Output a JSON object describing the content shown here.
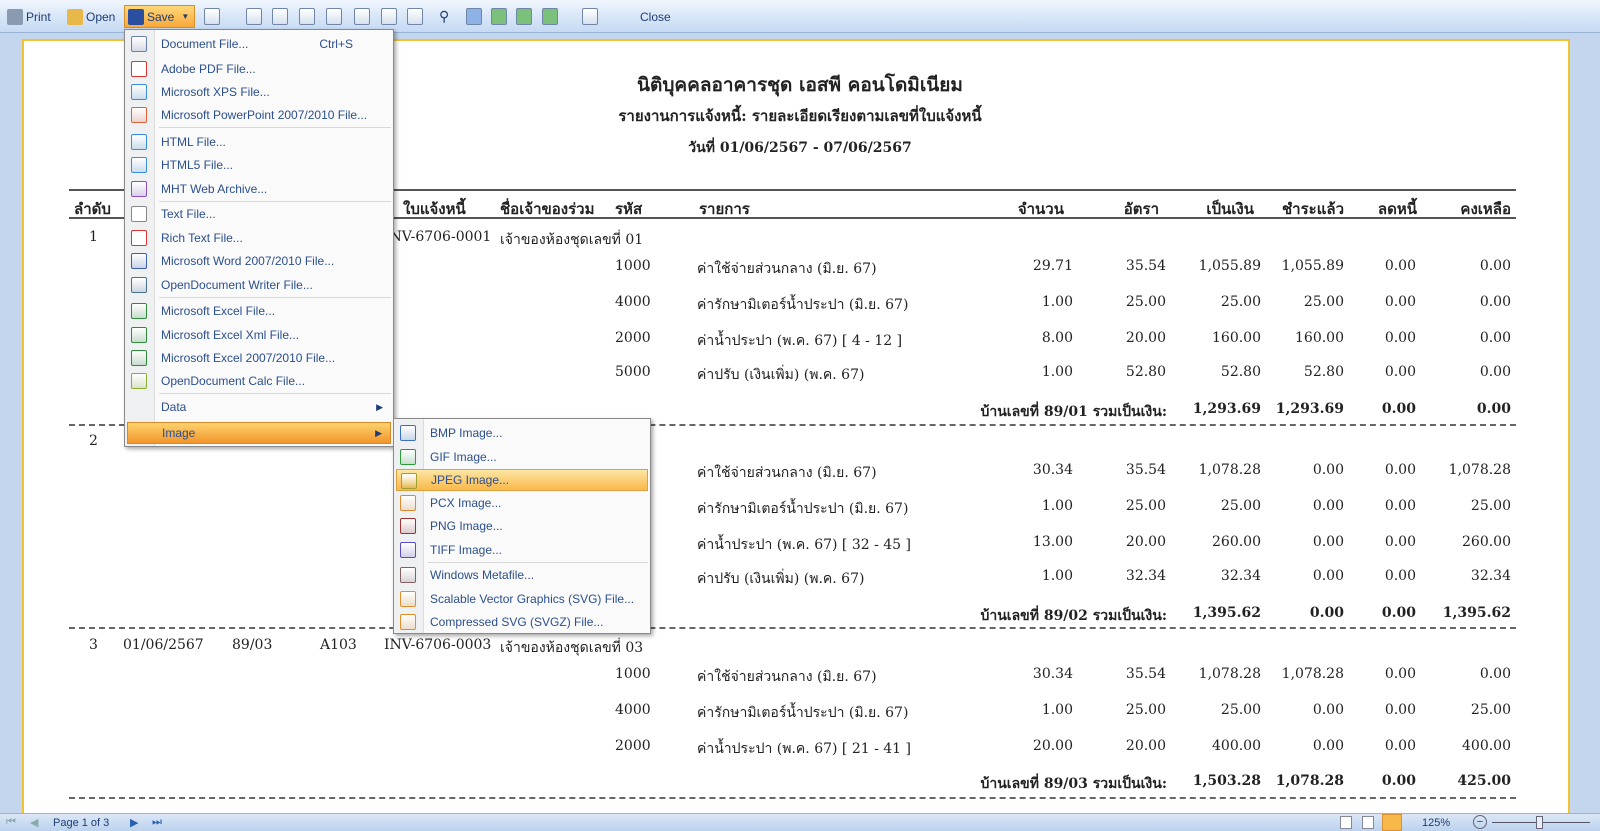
{
  "toolbar": {
    "print": "Print",
    "open": "Open",
    "save": "Save",
    "close": "Close"
  },
  "report": {
    "title": "นิติบุคคลอาคารชุด เอสพี คอนโดมิเนียม",
    "subtitle": "รายงานการแจ้งหนี้: รายละเอียดเรียงตามเลขที่ใบแจ้งหนี้",
    "date_range": "วันที่ 01/06/2567 - 07/06/2567",
    "columns": {
      "seq": "ลำดับ",
      "invoice": "ใบแจ้งหนี้",
      "owner": "ชื่อเจ้าของร่วม",
      "code": "รหัส",
      "item": "รายการ",
      "qty": "จำนวน",
      "rate": "อัตรา",
      "amount": "เป็นเงิน",
      "paid": "ชำระแล้ว",
      "discount": "ลดหนี้",
      "balance": "คงเหลือ"
    },
    "groups": [
      {
        "seq": "1",
        "date": "",
        "house": "",
        "room": "",
        "invoice": "INV-6706-0001",
        "owner": "เจ้าของห้องชุดเลขที่ 01",
        "lines": [
          [
            "1000",
            "ค่าใช้จ่ายส่วนกลาง (มิ.ย. 67)",
            "29.71",
            "35.54",
            "1,055.89",
            "1,055.89",
            "0.00",
            "0.00"
          ],
          [
            "4000",
            "ค่ารักษามิเตอร์น้ำประปา (มิ.ย. 67)",
            "1.00",
            "25.00",
            "25.00",
            "25.00",
            "0.00",
            "0.00"
          ],
          [
            "2000",
            "ค่าน้ำประปา (พ.ค. 67) [ 4 - 12 ]",
            "8.00",
            "20.00",
            "160.00",
            "160.00",
            "0.00",
            "0.00"
          ],
          [
            "5000",
            "ค่าปรับ (เงินเพิ่ม) (พ.ค. 67)",
            "1.00",
            "52.80",
            "52.80",
            "52.80",
            "0.00",
            "0.00"
          ]
        ],
        "total": {
          "label": "บ้านเลขที่ 89/01 รวมเป็นเงิน:",
          "amount": "1,293.69",
          "paid": "1,293.69",
          "discount": "0.00",
          "balance": "0.00"
        }
      },
      {
        "seq": "2",
        "date": "",
        "house": "",
        "room": "",
        "invoice": "",
        "owner": "",
        "lines": [
          [
            "",
            "ค่าใช้จ่ายส่วนกลาง (มิ.ย. 67)",
            "30.34",
            "35.54",
            "1,078.28",
            "0.00",
            "0.00",
            "1,078.28"
          ],
          [
            "",
            "ค่ารักษามิเตอร์น้ำประปา (มิ.ย. 67)",
            "1.00",
            "25.00",
            "25.00",
            "0.00",
            "0.00",
            "25.00"
          ],
          [
            "",
            "ค่าน้ำประปา (พ.ค. 67) [ 32 - 45 ]",
            "13.00",
            "20.00",
            "260.00",
            "0.00",
            "0.00",
            "260.00"
          ],
          [
            "",
            "ค่าปรับ (เงินเพิ่ม) (พ.ค. 67)",
            "1.00",
            "32.34",
            "32.34",
            "0.00",
            "0.00",
            "32.34"
          ]
        ],
        "total": {
          "label": "บ้านเลขที่ 89/02 รวมเป็นเงิน:",
          "amount": "1,395.62",
          "paid": "0.00",
          "discount": "0.00",
          "balance": "1,395.62"
        }
      },
      {
        "seq": "3",
        "date": "01/06/2567",
        "house": "89/03",
        "room": "A103",
        "invoice": "INV-6706-0003",
        "owner": "เจ้าของห้องชุดเลขที่ 03",
        "lines": [
          [
            "1000",
            "ค่าใช้จ่ายส่วนกลาง (มิ.ย. 67)",
            "30.34",
            "35.54",
            "1,078.28",
            "1,078.28",
            "0.00",
            "0.00"
          ],
          [
            "4000",
            "ค่ารักษามิเตอร์น้ำประปา (มิ.ย. 67)",
            "1.00",
            "25.00",
            "25.00",
            "0.00",
            "0.00",
            "25.00"
          ],
          [
            "2000",
            "ค่าน้ำประปา (พ.ค. 67) [ 21 - 41 ]",
            "20.00",
            "20.00",
            "400.00",
            "0.00",
            "0.00",
            "400.00"
          ]
        ],
        "total": {
          "label": "บ้านเลขที่ 89/03 รวมเป็นเงิน:",
          "amount": "1,503.28",
          "paid": "1,078.28",
          "discount": "0.00",
          "balance": "425.00"
        }
      }
    ]
  },
  "save_menu": [
    {
      "label": "Document File...",
      "shortcut": "Ctrl+S",
      "icon": "document-file-icon",
      "color": "#6b7fa8"
    },
    {
      "label": "Adobe PDF File...",
      "icon": "pdf-icon",
      "color": "#d33"
    },
    {
      "label": "Microsoft XPS File...",
      "icon": "xps-icon",
      "color": "#3a8ed8"
    },
    {
      "label": "Microsoft PowerPoint 2007/2010 File...",
      "icon": "powerpoint-icon",
      "color": "#e0603a",
      "sep": true
    },
    {
      "label": "HTML File...",
      "icon": "html-icon",
      "color": "#3a8ed8"
    },
    {
      "label": "HTML5 File...",
      "icon": "html5-icon",
      "color": "#3a8ed8"
    },
    {
      "label": "MHT Web Archive...",
      "icon": "mht-icon",
      "color": "#8a4fc0",
      "sep": true
    },
    {
      "label": "Text File...",
      "icon": "text-file-icon",
      "color": "#888"
    },
    {
      "label": "Rich Text File...",
      "icon": "rtf-icon",
      "color": "#d33"
    },
    {
      "label": "Microsoft Word 2007/2010 File...",
      "icon": "word-icon",
      "color": "#3a5fb0"
    },
    {
      "label": "OpenDocument Writer File...",
      "icon": "odt-icon",
      "color": "#4a7090",
      "sep": true
    },
    {
      "label": "Microsoft Excel File...",
      "icon": "excel-icon",
      "color": "#2e8b3a"
    },
    {
      "label": "Microsoft Excel Xml File...",
      "icon": "excel-xml-icon",
      "color": "#2e8b3a"
    },
    {
      "label": "Microsoft Excel 2007/2010 File...",
      "icon": "excel-2007-icon",
      "color": "#2e8b3a"
    },
    {
      "label": "OpenDocument Calc File...",
      "icon": "ods-icon",
      "color": "#8ab030",
      "sep": true
    },
    {
      "label": "Data",
      "icon": "",
      "submenu": true
    },
    {
      "label": "Image",
      "icon": "",
      "submenu": true,
      "selected": true
    }
  ],
  "image_menu": [
    {
      "label": "BMP Image...",
      "icon": "bmp-icon",
      "color": "#3a6fc0"
    },
    {
      "label": "GIF Image...",
      "icon": "gif-icon",
      "color": "#2e9b3a"
    },
    {
      "label": "JPEG Image...",
      "icon": "jpeg-icon",
      "color": "#a0a030",
      "selected": true
    },
    {
      "label": "PCX Image...",
      "icon": "pcx-icon",
      "color": "#e08a30"
    },
    {
      "label": "PNG Image...",
      "icon": "png-icon",
      "color": "#a03030"
    },
    {
      "label": "TIFF Image...",
      "icon": "tiff-icon",
      "color": "#5a4fc0",
      "sep": true
    },
    {
      "label": "Windows Metafile...",
      "icon": "wmf-icon",
      "color": "#806060"
    },
    {
      "label": "Scalable Vector Graphics (SVG) File...",
      "icon": "svg-icon",
      "color": "#e0902a"
    },
    {
      "label": "Compressed SVG (SVGZ) File...",
      "icon": "svgz-icon",
      "color": "#e0902a"
    }
  ],
  "statusbar": {
    "page": "Page 1 of 3",
    "zoom": "125%"
  }
}
